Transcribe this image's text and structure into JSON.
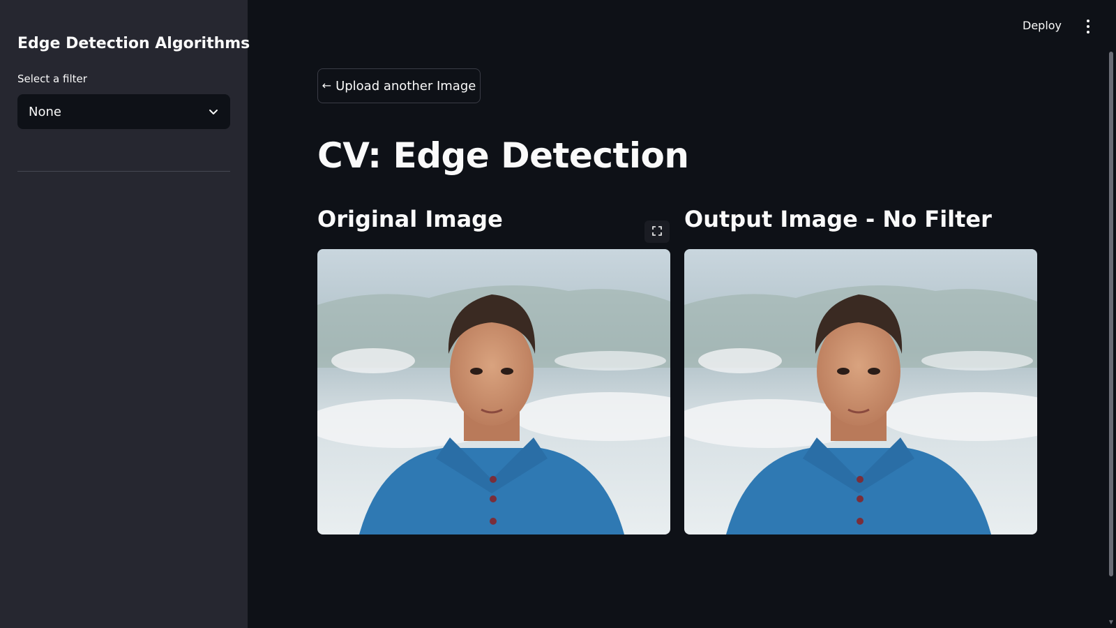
{
  "sidebar": {
    "title": "Edge Detection Algorithms",
    "filter_label": "Select a filter",
    "filter_value": "None"
  },
  "header": {
    "deploy_label": "Deploy"
  },
  "main": {
    "upload_button_label": "Upload another Image",
    "upload_button_icon": "arrow-left-icon",
    "title": "CV: Edge Detection",
    "original_heading": "Original Image",
    "output_heading": "Output Image - No Filter"
  },
  "colors": {
    "app_background": "#0e1117",
    "sidebar_background": "#262730",
    "text": "#fafafa"
  }
}
